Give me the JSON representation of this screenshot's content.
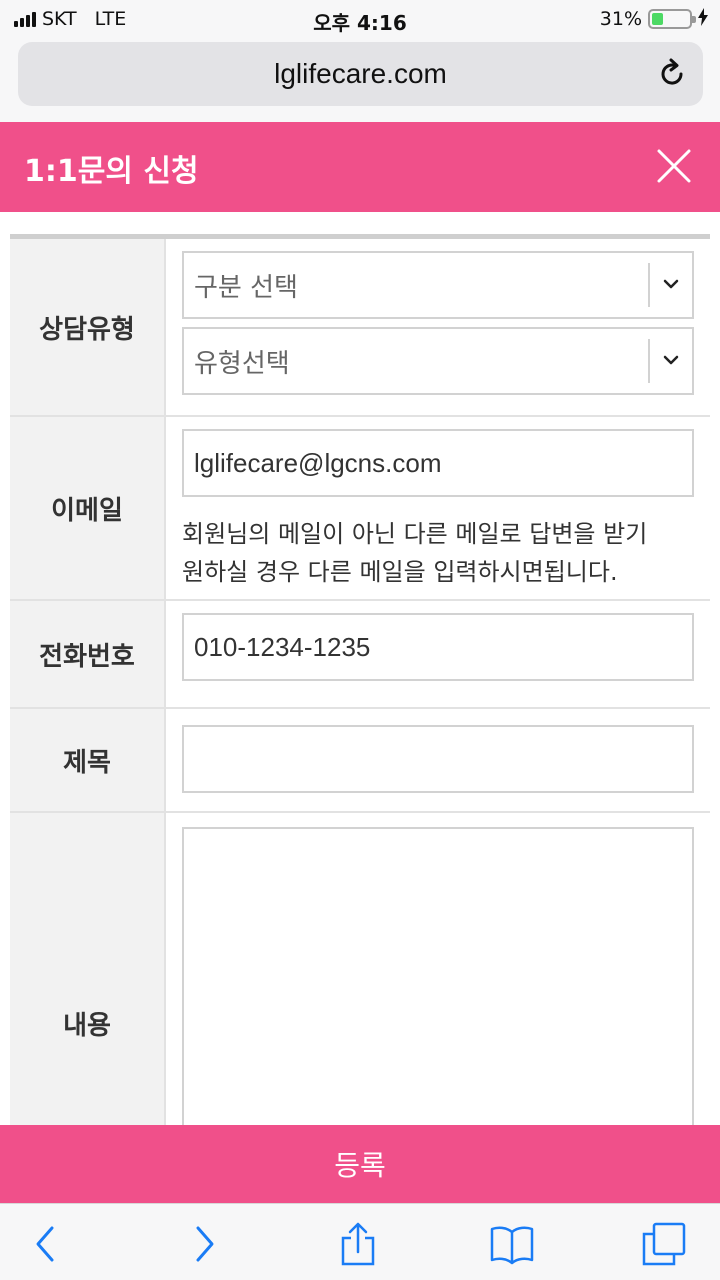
{
  "status_bar": {
    "carrier": "SKT",
    "network": "LTE",
    "time": "오후 4:16",
    "battery": "31%",
    "battery_level": 0.31
  },
  "browser": {
    "url": "lglifecare.com"
  },
  "header": {
    "title": "1:1문의 신청"
  },
  "form": {
    "consult_type": {
      "label": "상담유형",
      "category_select": "구분 선택",
      "type_select": "유형선택"
    },
    "email": {
      "label": "이메일",
      "value": "lglifecare@lgcns.com",
      "help_line1": "회원님의 메일이 아닌 다른 메일로 답변을 받기",
      "help_line2": "원하실 경우 다른 메일을 입력하시면됩니다."
    },
    "phone": {
      "label": "전화번호",
      "value": "010-1234-1235"
    },
    "subject": {
      "label": "제목",
      "value": ""
    },
    "content": {
      "label": "내용",
      "value": ""
    }
  },
  "submit_label": "등록",
  "colors": {
    "accent": "#f0508a",
    "toolbar_icon": "#1a7cf5",
    "battery": "#4cd964"
  },
  "icons": [
    "signal-icon",
    "battery-icon",
    "reload-icon",
    "close-icon",
    "chevron-down-icon",
    "back-icon",
    "forward-icon",
    "share-icon",
    "bookmarks-icon",
    "tabs-icon"
  ]
}
